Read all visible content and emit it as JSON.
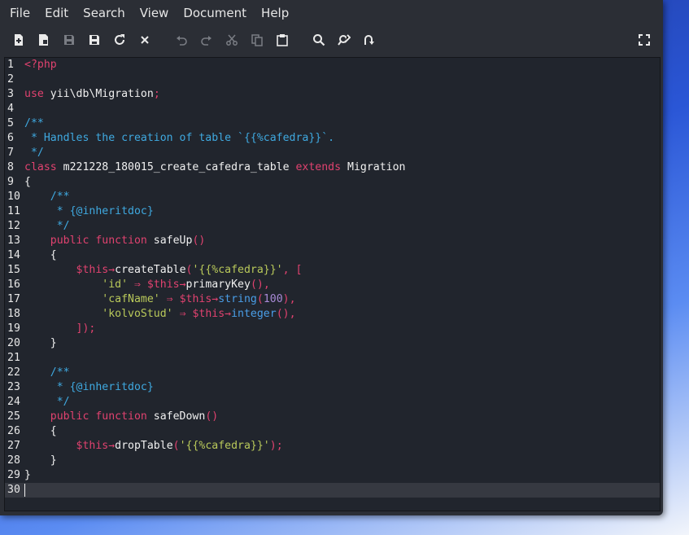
{
  "menu": [
    "File",
    "Edit",
    "Search",
    "View",
    "Document",
    "Help"
  ],
  "toolbar": {
    "icons": [
      "new-file-icon",
      "copy-file-icon",
      "save-icon",
      "save-as-icon",
      "reload-icon",
      "close-icon",
      "undo-icon",
      "redo-icon",
      "cut-icon",
      "copy-icon",
      "paste-icon",
      "search-icon",
      "replace-icon",
      "goto-line-icon",
      "fullscreen-icon"
    ]
  },
  "editor": {
    "current_line": 30,
    "lines": [
      {
        "n": "1",
        "tokens": [
          [
            "k",
            "<?php"
          ]
        ]
      },
      {
        "n": "2",
        "tokens": []
      },
      {
        "n": "3",
        "tokens": [
          [
            "k",
            "use "
          ],
          [
            "t",
            "yii\\db\\Migration"
          ],
          [
            "k",
            ";"
          ]
        ]
      },
      {
        "n": "4",
        "tokens": []
      },
      {
        "n": "5",
        "tokens": [
          [
            "c",
            "/**"
          ]
        ]
      },
      {
        "n": "6",
        "tokens": [
          [
            "c",
            " * Handles the creation of table `{{%cafedra}}`."
          ]
        ]
      },
      {
        "n": "7",
        "tokens": [
          [
            "c",
            " */"
          ]
        ]
      },
      {
        "n": "8",
        "tokens": [
          [
            "k",
            "class "
          ],
          [
            "t",
            "m221228_180015_create_cafedra_table "
          ],
          [
            "k",
            "extends "
          ],
          [
            "t",
            "Migration"
          ]
        ]
      },
      {
        "n": "9",
        "tokens": [
          [
            "t",
            "{"
          ]
        ]
      },
      {
        "n": "10",
        "tokens": [
          [
            "c",
            "    /**"
          ]
        ]
      },
      {
        "n": "11",
        "tokens": [
          [
            "c",
            "     * {@inheritdoc}"
          ]
        ]
      },
      {
        "n": "12",
        "tokens": [
          [
            "c",
            "     */"
          ]
        ]
      },
      {
        "n": "13",
        "tokens": [
          [
            "k",
            "    public function "
          ],
          [
            "t",
            "safeUp"
          ],
          [
            "p",
            "()"
          ]
        ]
      },
      {
        "n": "14",
        "tokens": [
          [
            "t",
            "    {"
          ]
        ]
      },
      {
        "n": "15",
        "tokens": [
          [
            "v",
            "        $this"
          ],
          [
            "p",
            "→"
          ],
          [
            "t",
            "createTable"
          ],
          [
            "p",
            "("
          ],
          [
            "str",
            "'{{%cafedra}}'"
          ],
          [
            "p",
            ", ["
          ]
        ]
      },
      {
        "n": "16",
        "tokens": [
          [
            "str",
            "            'id'"
          ],
          [
            "p",
            " ⇒ "
          ],
          [
            "v",
            "$this"
          ],
          [
            "p",
            "→"
          ],
          [
            "t",
            "primaryKey"
          ],
          [
            "p",
            "(),"
          ]
        ]
      },
      {
        "n": "17",
        "tokens": [
          [
            "str",
            "            'cafName'"
          ],
          [
            "p",
            " ⇒ "
          ],
          [
            "v",
            "$this"
          ],
          [
            "p",
            "→"
          ],
          [
            "m",
            "string"
          ],
          [
            "p",
            "("
          ],
          [
            "n",
            "100"
          ],
          [
            "p",
            "),"
          ]
        ]
      },
      {
        "n": "18",
        "tokens": [
          [
            "str",
            "            'kolvoStud'"
          ],
          [
            "p",
            " ⇒ "
          ],
          [
            "v",
            "$this"
          ],
          [
            "p",
            "→"
          ],
          [
            "m",
            "integer"
          ],
          [
            "p",
            "(),"
          ]
        ]
      },
      {
        "n": "19",
        "tokens": [
          [
            "p",
            "        ]);"
          ]
        ]
      },
      {
        "n": "20",
        "tokens": [
          [
            "t",
            "    }"
          ]
        ]
      },
      {
        "n": "21",
        "tokens": []
      },
      {
        "n": "22",
        "tokens": [
          [
            "c",
            "    /**"
          ]
        ]
      },
      {
        "n": "23",
        "tokens": [
          [
            "c",
            "     * {@inheritdoc}"
          ]
        ]
      },
      {
        "n": "24",
        "tokens": [
          [
            "c",
            "     */"
          ]
        ]
      },
      {
        "n": "25",
        "tokens": [
          [
            "k",
            "    public function "
          ],
          [
            "t",
            "safeDown"
          ],
          [
            "p",
            "()"
          ]
        ]
      },
      {
        "n": "26",
        "tokens": [
          [
            "t",
            "    {"
          ]
        ]
      },
      {
        "n": "27",
        "tokens": [
          [
            "v",
            "        $this"
          ],
          [
            "p",
            "→"
          ],
          [
            "t",
            "dropTable"
          ],
          [
            "p",
            "("
          ],
          [
            "str",
            "'{{%cafedra}}'"
          ],
          [
            "p",
            ");"
          ]
        ]
      },
      {
        "n": "28",
        "tokens": [
          [
            "t",
            "    }"
          ]
        ]
      },
      {
        "n": "29",
        "tokens": [
          [
            "t",
            "}"
          ]
        ]
      },
      {
        "n": "30",
        "tokens": []
      }
    ]
  }
}
